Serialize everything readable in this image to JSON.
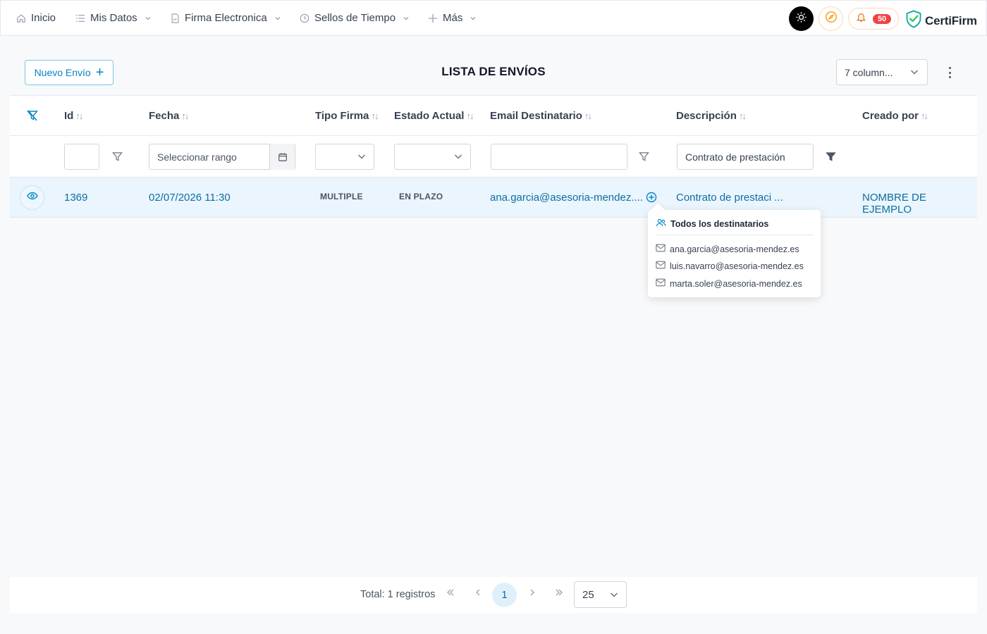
{
  "nav": {
    "items": [
      {
        "label": "Inicio",
        "icon": "home-icon",
        "dropdown": false
      },
      {
        "label": "Mis Datos",
        "icon": "list-icon",
        "dropdown": true
      },
      {
        "label": "Firma Electronica",
        "icon": "file-signature-icon",
        "dropdown": true
      },
      {
        "label": "Sellos de Tiempo",
        "icon": "clock-icon",
        "dropdown": true
      },
      {
        "label": "Más",
        "icon": "plus-icon",
        "dropdown": true
      }
    ],
    "notifications_count": "50",
    "brand_name": "CertiFirm",
    "brand_color": "#0ea5a4"
  },
  "toolbar": {
    "new_button_label": "Nuevo Envío",
    "title": "LISTA DE ENVÍOS",
    "columns_select": "7 column..."
  },
  "table": {
    "headers": [
      "Id",
      "Fecha",
      "Tipo Firma",
      "Estado Actual",
      "Email Destinatario",
      "Descripción",
      "Creado por"
    ],
    "filters": {
      "id": "",
      "fecha_placeholder": "Seleccionar rango",
      "tipo_firma": "",
      "estado_actual": "",
      "email": "",
      "descripcion": "Contrato de prestación"
    },
    "rows": [
      {
        "id": "1369",
        "fecha": "02/07/2026 11:30",
        "tipo_firma": "MULTIPLE",
        "estado": "EN PLAZO",
        "email": "ana.garcia@asesoria-mendez....",
        "descripcion": "Contrato de prestaci ...",
        "creado_por": "NOMBRE DE EJEMPLO"
      }
    ]
  },
  "popover": {
    "title": "Todos los destinatarios",
    "emails": [
      "ana.garcia@asesoria-mendez.es",
      "luis.navarro@asesoria-mendez.es",
      "marta.soler@asesoria-mendez.es"
    ]
  },
  "pager": {
    "total": "Total: 1 registros",
    "current_page": "1",
    "per_page": "25"
  },
  "colors": {
    "accent": "#0284c7",
    "row_highlight": "#eaf5fd",
    "badge": "#ef4444"
  }
}
